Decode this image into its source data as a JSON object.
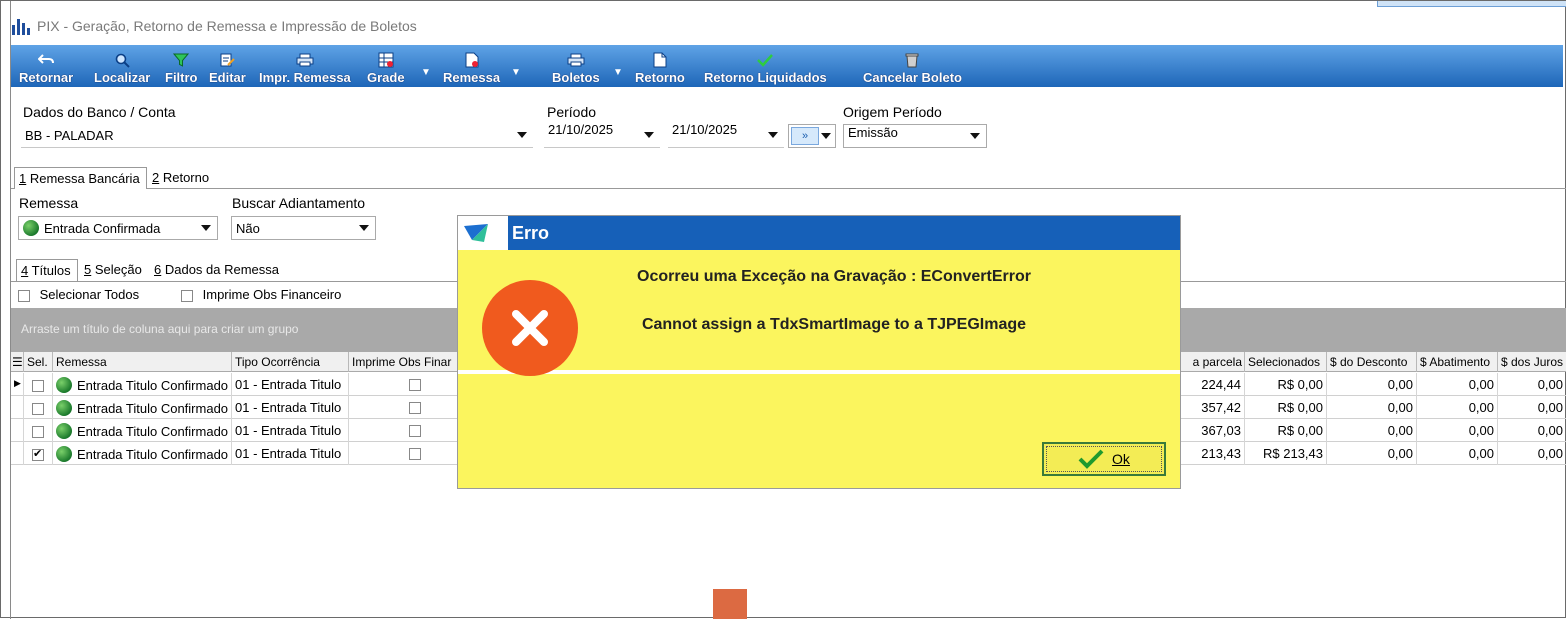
{
  "window": {
    "title": "PIX - Geração, Retorno de Remessa e Impressão de Boletos"
  },
  "toolbar": {
    "items": [
      {
        "label": "Retornar",
        "icon": "undo-icon"
      },
      {
        "label": "Localizar",
        "icon": "magnifier-icon"
      },
      {
        "label": "Filtro",
        "icon": "funnel-icon"
      },
      {
        "label": "Editar",
        "icon": "edit-icon"
      },
      {
        "label": "Impr. Remessa",
        "icon": "printer-icon"
      },
      {
        "label": "Grade",
        "icon": "grid-icon"
      },
      {
        "label": "Remessa",
        "icon": "document-icon"
      },
      {
        "label": "Boletos",
        "icon": "printer-icon"
      },
      {
        "label": "Retorno",
        "icon": "document-icon"
      },
      {
        "label": "Retorno Liquidados",
        "icon": "check-icon"
      },
      {
        "label": "Cancelar Boleto",
        "icon": "trash-icon"
      }
    ]
  },
  "form": {
    "bank_label": "Dados do Banco / Conta",
    "bank_value": "BB - PALADAR",
    "period_label": "Período",
    "period_from": "21/10/2025",
    "period_to": "21/10/2025",
    "period_btn": "»",
    "origin_label": "Origem Período",
    "origin_value": "Emissão"
  },
  "tabs_main": [
    {
      "num": "1",
      "label": " Remessa Bancária"
    },
    {
      "num": "2",
      "label": " Retorno"
    }
  ],
  "remessa": {
    "label": "Remessa",
    "value": "Entrada Confirmada",
    "adiant_label": "Buscar Adiantamento",
    "adiant_value": "Não"
  },
  "tabs_sub": [
    {
      "num": "4",
      "label": " Títulos"
    },
    {
      "num": "5",
      "label": " Seleção"
    },
    {
      "num": "6",
      "label": " Dados da Remessa"
    }
  ],
  "options": {
    "select_all": "Selecionar Todos",
    "print_obs": "Imprime Obs Financeiro"
  },
  "grid": {
    "group_hint": "Arraste um título de coluna aqui para criar um grupo",
    "headers": {
      "sel": "Sel.",
      "remessa": "Remessa",
      "tipo": "Tipo Ocorrência",
      "imprime": "Imprime Obs Finar",
      "parcela": "a parcela",
      "selecionados": "Selecionados",
      "desconto": "$ do Desconto",
      "abatimento": "$ Abatimento",
      "juros": "$ dos Juros"
    },
    "rows": [
      {
        "checked": false,
        "remessa": "Entrada Titulo Confirmado",
        "tipo": "01 - Entrada Titulo",
        "parcela": "224,44",
        "selecionados": "R$ 0,00",
        "desconto": "0,00",
        "abatimento": "0,00",
        "juros": "0,00"
      },
      {
        "checked": false,
        "remessa": "Entrada Titulo Confirmado",
        "tipo": "01 - Entrada Titulo",
        "parcela": "357,42",
        "selecionados": "R$ 0,00",
        "desconto": "0,00",
        "abatimento": "0,00",
        "juros": "0,00"
      },
      {
        "checked": false,
        "remessa": "Entrada Titulo Confirmado",
        "tipo": "01 - Entrada Titulo",
        "parcela": "367,03",
        "selecionados": "R$ 0,00",
        "desconto": "0,00",
        "abatimento": "0,00",
        "juros": "0,00"
      },
      {
        "checked": true,
        "remessa": "Entrada Titulo Confirmado",
        "tipo": "01 - Entrada Titulo",
        "parcela": "213,43",
        "selecionados": "R$ 213,43",
        "desconto": "0,00",
        "abatimento": "0,00",
        "juros": "0,00"
      }
    ]
  },
  "dialog": {
    "title": "Erro",
    "line1": "Ocorreu uma Exceção na Gravação : EConvertError",
    "line2": "Cannot assign a TdxSmartImage to a TJPEGImage",
    "ok_label": "Ok"
  },
  "colors": {
    "toolbar": "#1e66b8",
    "dialog_header": "#1660b8",
    "dialog_body": "#fbf55e",
    "error_icon": "#f05a1e"
  }
}
